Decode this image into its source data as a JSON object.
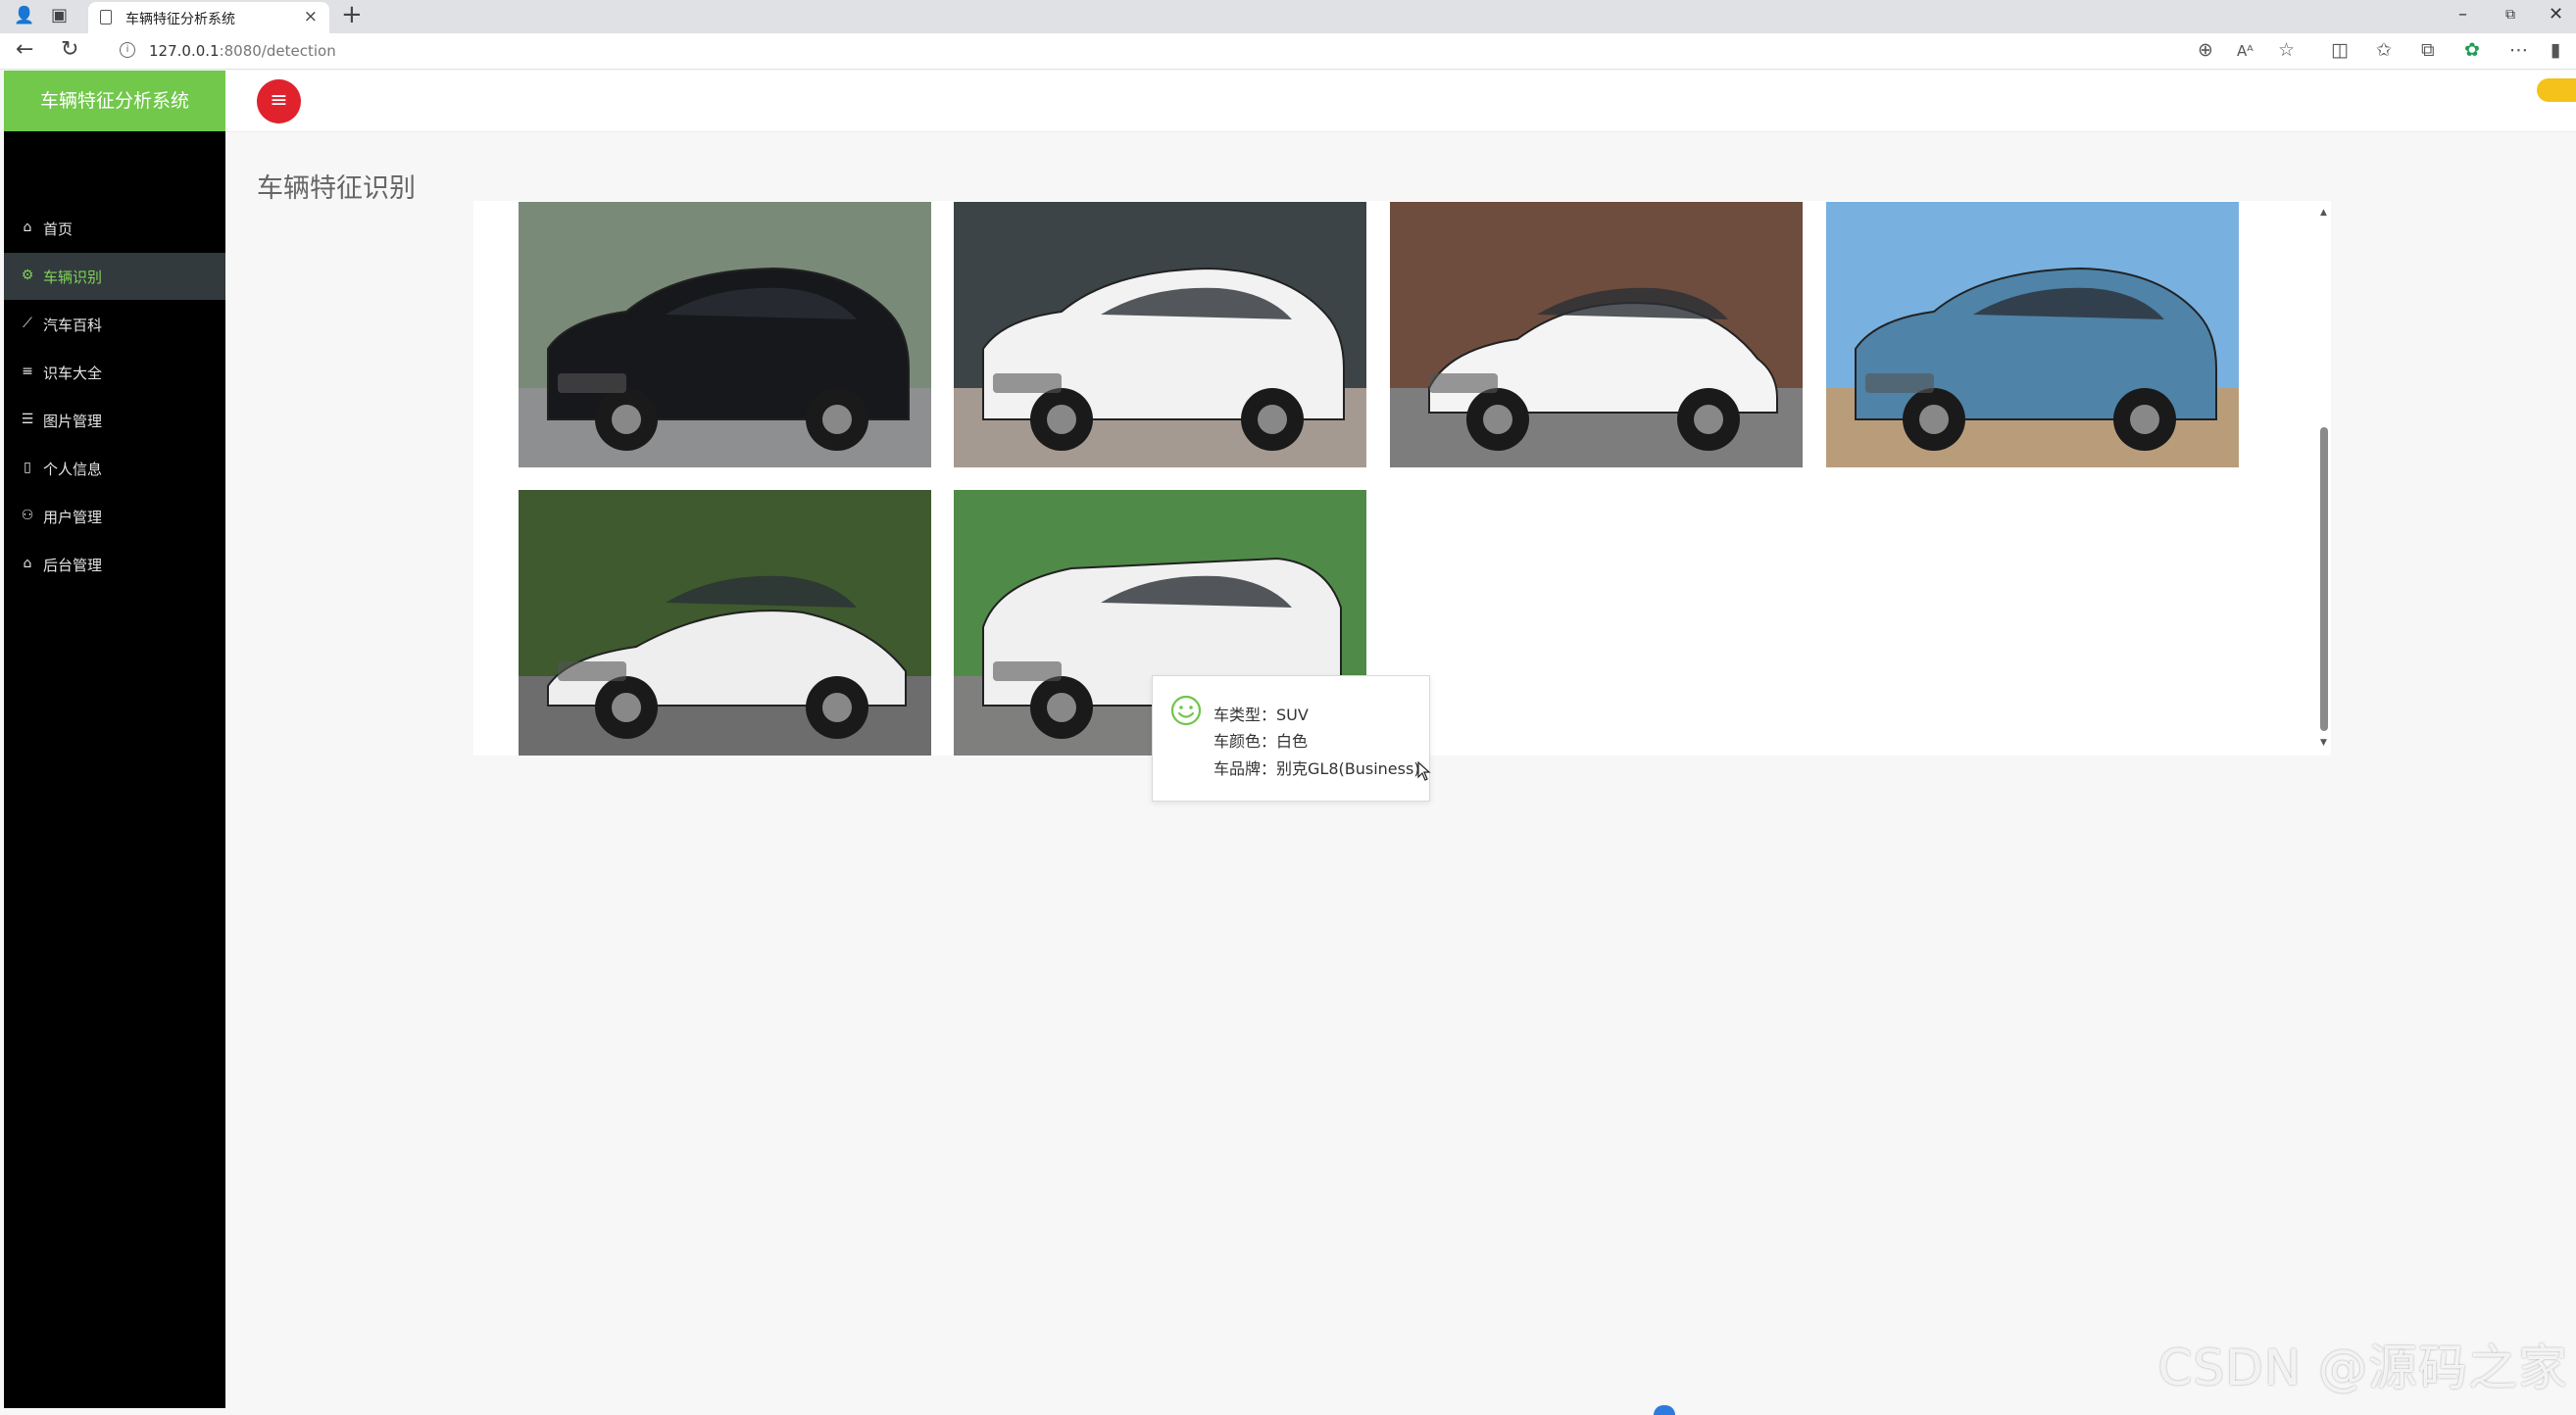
{
  "browser": {
    "tab_title": "车辆特征分析系统",
    "url_host": "127.0.0.1",
    "url_path": ":8080/detection"
  },
  "sidebar": {
    "brand": "车辆特征分析系统",
    "items": [
      {
        "label": "首页",
        "icon": "home-icon",
        "glyph": "⌂",
        "active": false
      },
      {
        "label": "车辆识别",
        "icon": "settings-icon",
        "glyph": "⚙",
        "active": true
      },
      {
        "label": "汽车百科",
        "icon": "chart-icon",
        "glyph": "⟋",
        "active": false
      },
      {
        "label": "识车大全",
        "icon": "list-icon",
        "glyph": "≡",
        "active": false
      },
      {
        "label": "图片管理",
        "icon": "list-icon",
        "glyph": "☰",
        "active": false
      },
      {
        "label": "个人信息",
        "icon": "phone-icon",
        "glyph": "▯",
        "active": false
      },
      {
        "label": "用户管理",
        "icon": "users-icon",
        "glyph": "⚇",
        "active": false
      },
      {
        "label": "后台管理",
        "icon": "home-icon",
        "glyph": "⌂",
        "active": false
      }
    ]
  },
  "page": {
    "title": "车辆特征识别"
  },
  "gallery": [
    {
      "name": "black-suv-image",
      "body": "#17181c",
      "bg": "#7a8a78",
      "ground": "#8d8f90",
      "type": "suv"
    },
    {
      "name": "white-crossover-image",
      "body": "#f2f2f2",
      "bg": "#3d4447",
      "ground": "#a59a92",
      "type": "suv"
    },
    {
      "name": "white-sedan-image",
      "body": "#f4f4f4",
      "bg": "#6e4d3f",
      "ground": "#7d7d7d",
      "type": "sedan"
    },
    {
      "name": "blue-offroad-image",
      "body": "#4f83a8",
      "bg": "#78b0e0",
      "ground": "#b99d7b",
      "type": "suv"
    },
    {
      "name": "white-supercar-image",
      "body": "#eeeeee",
      "bg": "#3e5a2e",
      "ground": "#6d6d6d",
      "type": "sport"
    },
    {
      "name": "white-minivan-image",
      "body": "#f0f0f0",
      "bg": "#4f8a48",
      "ground": "#7f807d",
      "type": "van"
    }
  ],
  "tooltip": {
    "type_line": "车类型：SUV",
    "color_line": "车颜色：白色",
    "brand_line": "车品牌：别克GL8(Business)",
    "icon": "smile-icon",
    "accent": "#6fc64a"
  },
  "watermark": "CSDN @源码之家",
  "colors": {
    "brand_green": "#71c84a",
    "menu_button_red": "#e0222d",
    "sidebar_bg": "#000000",
    "active_item_bg": "#333a3d"
  }
}
